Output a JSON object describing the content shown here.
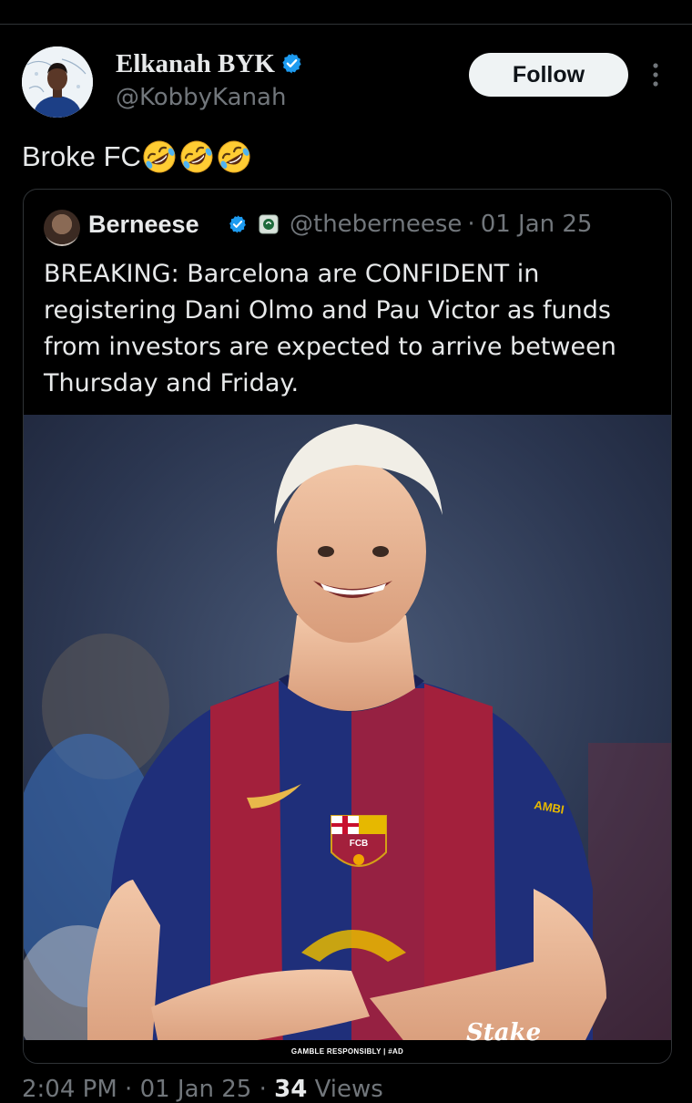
{
  "author": {
    "name": "Elkanah BYK",
    "handle": "@KobbyKanah"
  },
  "follow_label": "Follow",
  "post": {
    "text": "Broke FC",
    "emoji": [
      "rolling-on-floor-laughing",
      "rolling-on-floor-laughing",
      "rolling-on-floor-laughing"
    ]
  },
  "quote": {
    "name": "Berneese",
    "handle": "@theberneese",
    "separator": "·",
    "date": "01 Jan 25",
    "text": "BREAKING: Barcelona are CONFIDENT in registering Dani Olmo and Pau Victor as funds from investors are expected to arrive between Thursday and Friday.",
    "image": {
      "crest_text": "FCB",
      "sleeve_text": "AMBI",
      "footer_text": "GAMBLE RESPONSIBLY | #AD",
      "brand": "Stake"
    }
  },
  "footer": {
    "time": "2:04 PM",
    "separator": "·",
    "date": "01 Jan 25",
    "views_count": "34",
    "views_label": "Views"
  },
  "colors": {
    "background": "#000000",
    "verified": "#1d9bf0",
    "muted": "#71767b",
    "jersey_blue": "#1f2f7a",
    "jersey_red": "#a3203c"
  }
}
